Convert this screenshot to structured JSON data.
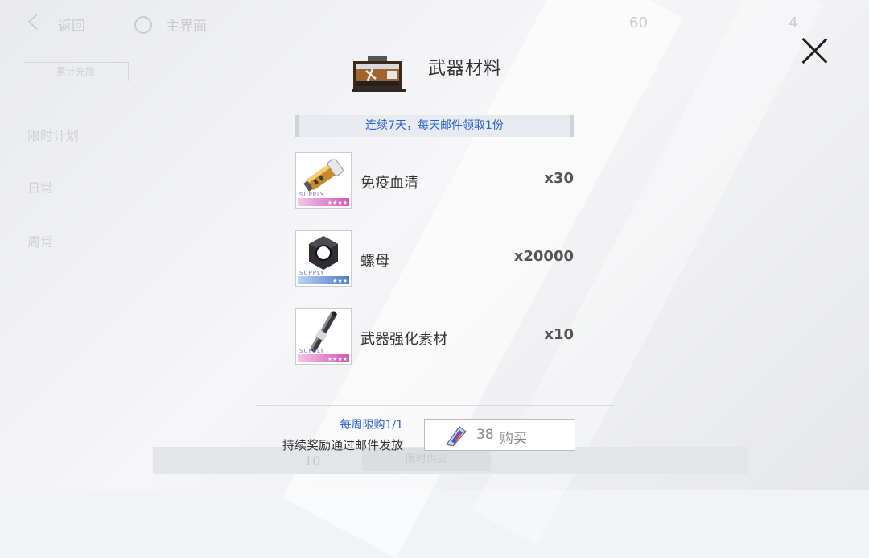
{
  "background": {
    "back_label": "返回",
    "home_label": "主界面",
    "currency_1": "60",
    "currency_2": "4",
    "pill_label": "累计充能",
    "side_items": [
      "限时计划",
      "日常",
      "周常"
    ],
    "bottom_num": "10",
    "bottom_btn": "限时供应"
  },
  "dialog": {
    "title": "武器材料",
    "header_icon": "supply-crate-icon",
    "info": "连续7天，每天邮件领取1份",
    "items": [
      {
        "name": "免疫血清",
        "qty": "x30",
        "icon": "serum-vial-icon",
        "rarity": "pink",
        "rarity_color": "#d354b6",
        "supply": "SUPPLY",
        "stars": "★★★★"
      },
      {
        "name": "螺母",
        "qty": "x20000",
        "icon": "hex-nut-icon",
        "rarity": "blue",
        "rarity_color": "#4d7bc9",
        "supply": "SUPPLY",
        "stars": "★★★"
      },
      {
        "name": "武器强化素材",
        "qty": "x10",
        "icon": "enhance-rod-icon",
        "rarity": "pink",
        "rarity_color": "#d354b6",
        "supply": "SUPPLY",
        "stars": "★★★★"
      }
    ],
    "limit_text": "每周限购1/1",
    "mail_note": "持续奖励通过邮件发放",
    "buy": {
      "price": "38",
      "label": "购买",
      "currency_icon": "crystal-currency-icon"
    },
    "close_icon": "close-icon",
    "accent_color": "#2c63c9"
  }
}
